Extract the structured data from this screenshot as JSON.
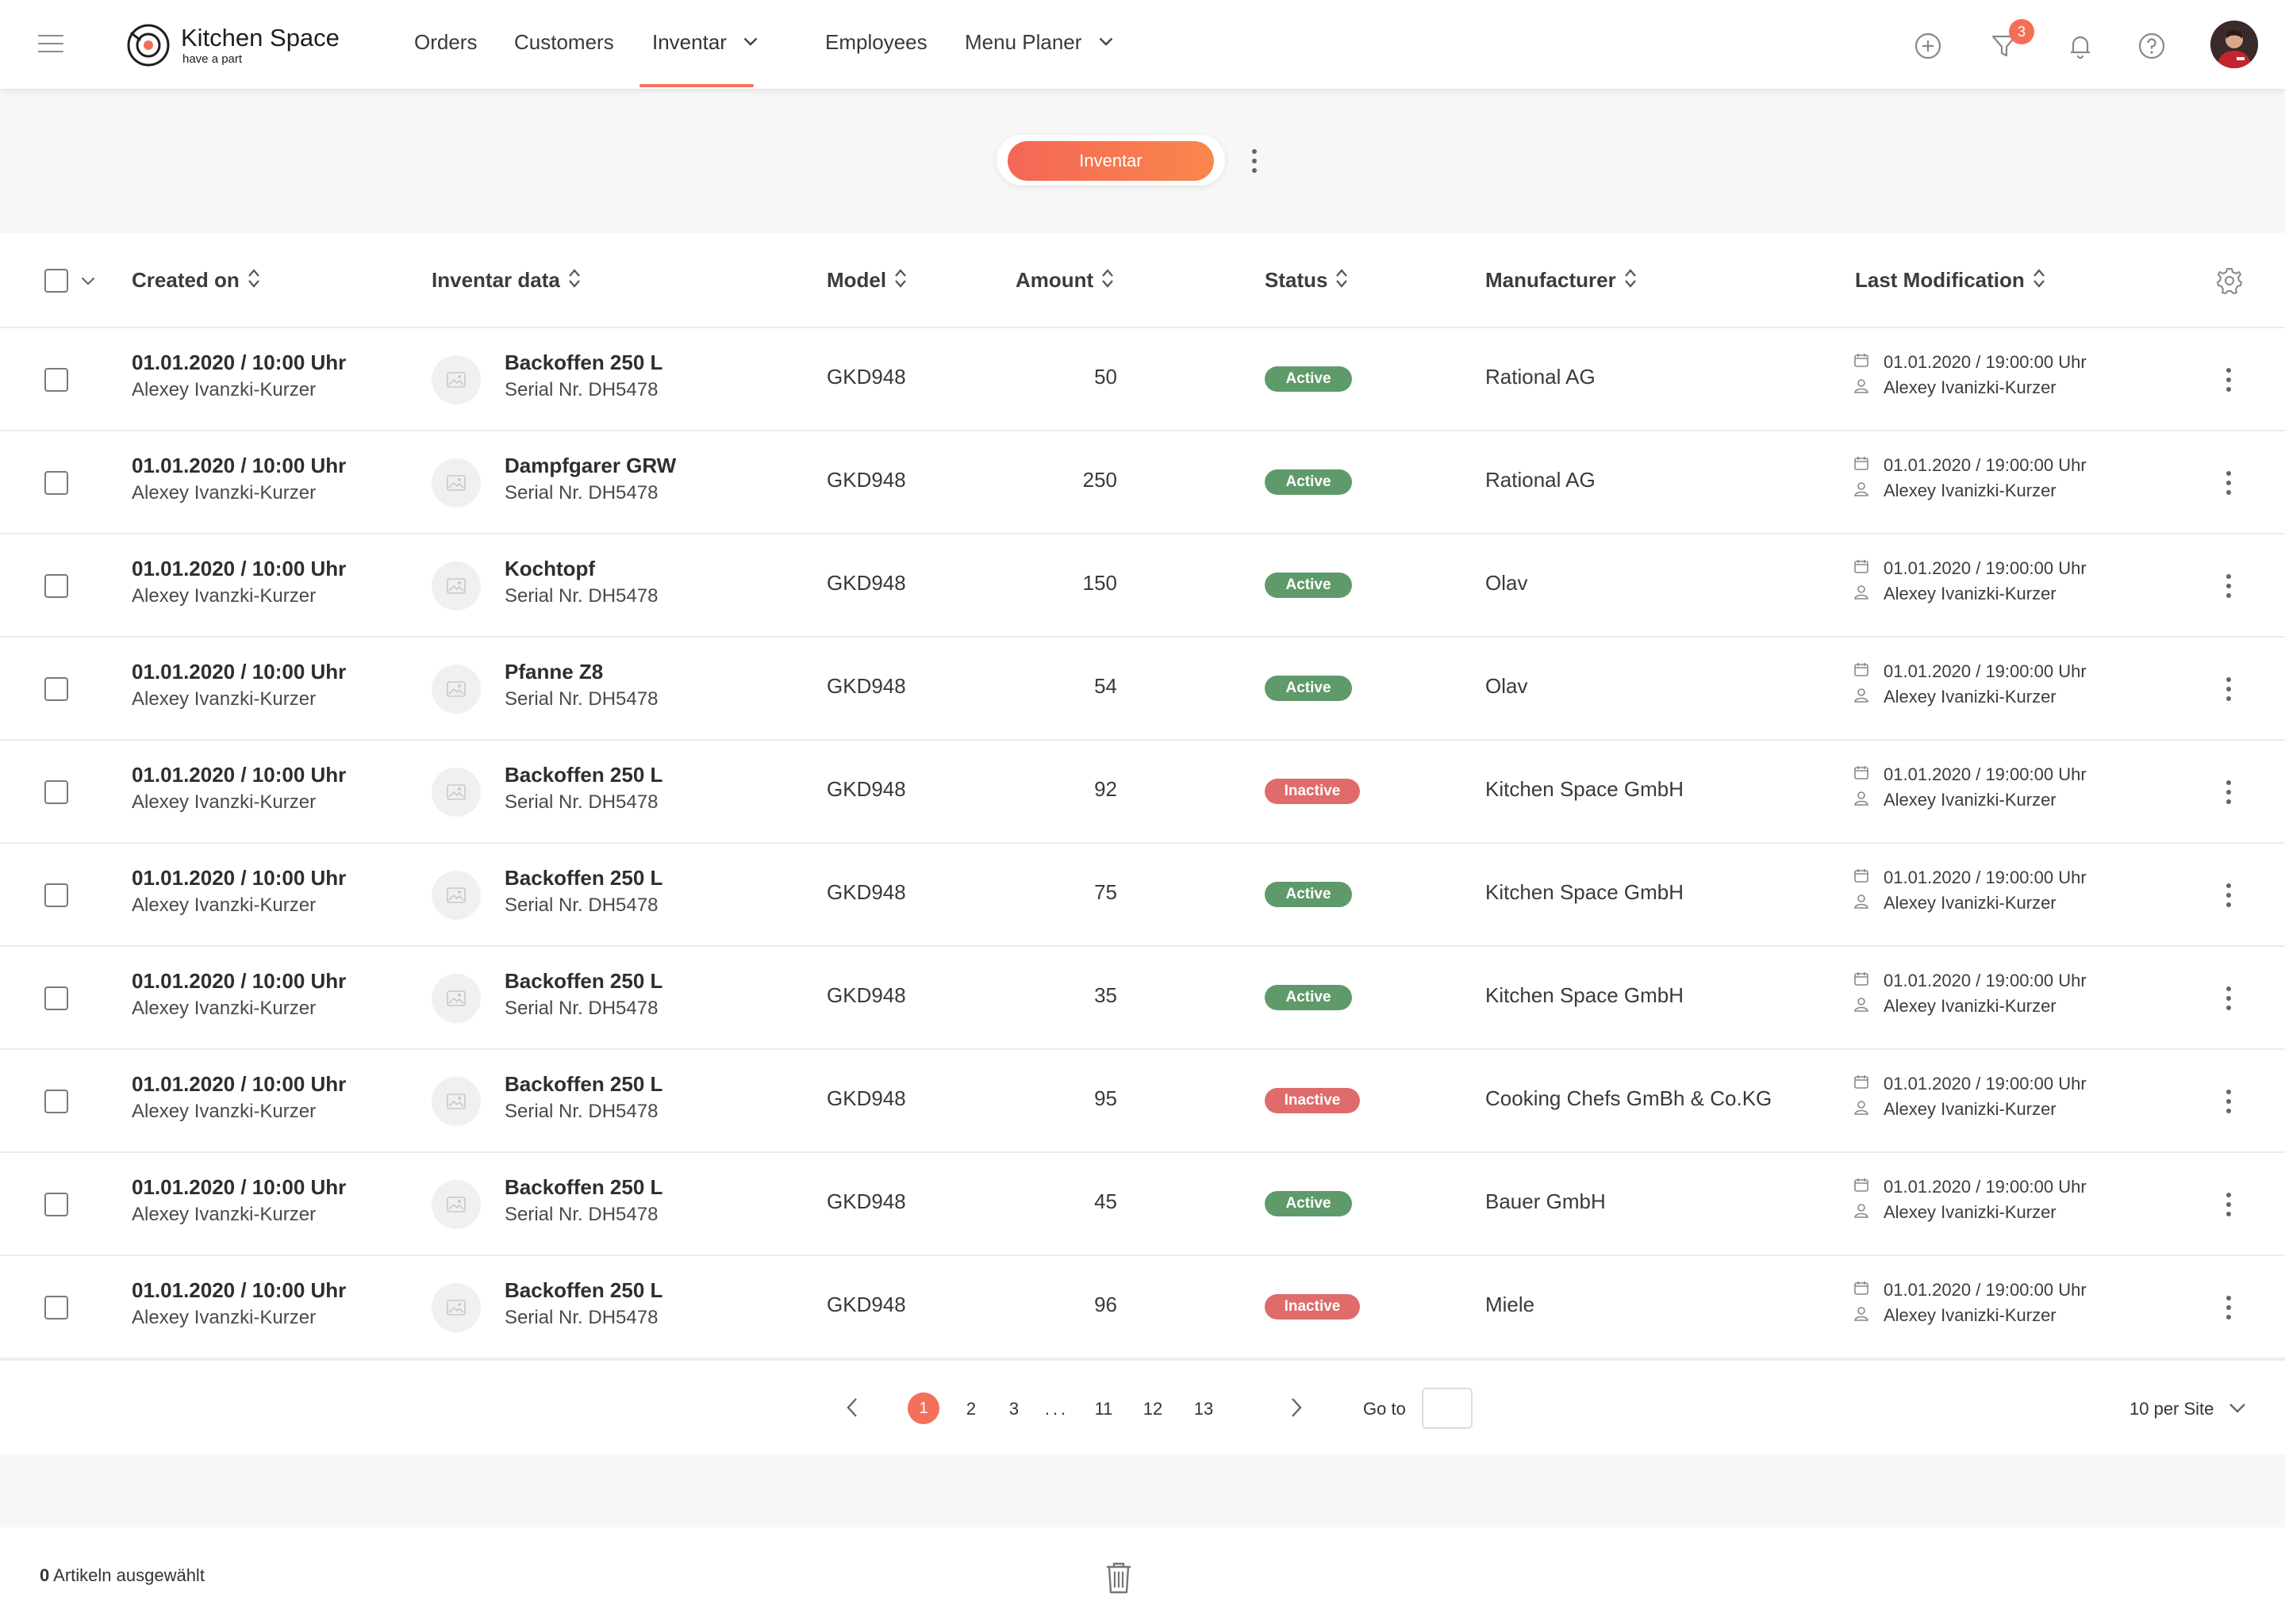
{
  "app": {
    "logo_name": "Kitchen Space",
    "logo_tagline": "have a part",
    "accent_color": "#f7735a"
  },
  "nav": {
    "items": [
      {
        "label": "Orders",
        "dropdown": false,
        "active": false
      },
      {
        "label": "Customers",
        "dropdown": false,
        "active": false
      },
      {
        "label": "Inventar",
        "dropdown": true,
        "active": true
      },
      {
        "label": "Employees",
        "dropdown": false,
        "active": false
      },
      {
        "label": "Menu Planer",
        "dropdown": true,
        "active": false
      }
    ]
  },
  "header_actions": {
    "icons": [
      "add-circle-icon",
      "filter-icon",
      "bell-icon",
      "help-icon"
    ],
    "filter_badge": "3"
  },
  "toolbar": {
    "primary_label": "Inventar"
  },
  "table": {
    "columns": [
      "Created on",
      "Inventar data",
      "Model",
      "Amount",
      "Status",
      "Manufacturer",
      "Last Modification"
    ],
    "rows": [
      {
        "created_date": "01.01.2020  /  10:00 Uhr",
        "created_by": "Alexey Ivanzki-Kurzer",
        "product": "Backoffen 250 L",
        "serial": "Serial Nr. DH5478",
        "model": "GKD948",
        "amount": "50",
        "status": "Active",
        "manufacturer": "Rational AG",
        "mod_date": "01.01.2020 / 19:00:00 Uhr",
        "mod_user": "Alexey Ivanizki-Kurzer"
      },
      {
        "created_date": "01.01.2020  /  10:00 Uhr",
        "created_by": "Alexey Ivanzki-Kurzer",
        "product": "Dampfgarer GRW",
        "serial": "Serial Nr. DH5478",
        "model": "GKD948",
        "amount": "250",
        "status": "Active",
        "manufacturer": "Rational AG",
        "mod_date": "01.01.2020 / 19:00:00 Uhr",
        "mod_user": "Alexey Ivanizki-Kurzer"
      },
      {
        "created_date": "01.01.2020  /  10:00 Uhr",
        "created_by": "Alexey Ivanzki-Kurzer",
        "product": "Kochtopf",
        "serial": "Serial Nr. DH5478",
        "model": "GKD948",
        "amount": "150",
        "status": "Active",
        "manufacturer": "Olav",
        "mod_date": "01.01.2020 / 19:00:00 Uhr",
        "mod_user": "Alexey Ivanizki-Kurzer"
      },
      {
        "created_date": "01.01.2020  /  10:00 Uhr",
        "created_by": "Alexey Ivanzki-Kurzer",
        "product": "Pfanne Z8",
        "serial": "Serial Nr. DH5478",
        "model": "GKD948",
        "amount": "54",
        "status": "Active",
        "manufacturer": "Olav",
        "mod_date": "01.01.2020 / 19:00:00 Uhr",
        "mod_user": "Alexey Ivanizki-Kurzer"
      },
      {
        "created_date": "01.01.2020  /  10:00 Uhr",
        "created_by": "Alexey Ivanzki-Kurzer",
        "product": "Backoffen 250 L",
        "serial": "Serial Nr. DH5478",
        "model": "GKD948",
        "amount": "92",
        "status": "Inactive",
        "manufacturer": "Kitchen Space GmbH",
        "mod_date": "01.01.2020 / 19:00:00 Uhr",
        "mod_user": "Alexey Ivanizki-Kurzer"
      },
      {
        "created_date": "01.01.2020  /  10:00 Uhr",
        "created_by": "Alexey Ivanzki-Kurzer",
        "product": "Backoffen 250 L",
        "serial": "Serial Nr. DH5478",
        "model": "GKD948",
        "amount": "75",
        "status": "Active",
        "manufacturer": "Kitchen Space GmbH",
        "mod_date": "01.01.2020 / 19:00:00 Uhr",
        "mod_user": "Alexey Ivanizki-Kurzer"
      },
      {
        "created_date": "01.01.2020  /  10:00 Uhr",
        "created_by": "Alexey Ivanzki-Kurzer",
        "product": "Backoffen 250 L",
        "serial": "Serial Nr. DH5478",
        "model": "GKD948",
        "amount": "35",
        "status": "Active",
        "manufacturer": "Kitchen Space GmbH",
        "mod_date": "01.01.2020 / 19:00:00 Uhr",
        "mod_user": "Alexey Ivanizki-Kurzer"
      },
      {
        "created_date": "01.01.2020  /  10:00 Uhr",
        "created_by": "Alexey Ivanzki-Kurzer",
        "product": "Backoffen 250 L",
        "serial": "Serial Nr. DH5478",
        "model": "GKD948",
        "amount": "95",
        "status": "Inactive",
        "manufacturer": "Cooking Chefs GmBh & Co.KG",
        "mod_date": "01.01.2020 / 19:00:00 Uhr",
        "mod_user": "Alexey Ivanizki-Kurzer"
      },
      {
        "created_date": "01.01.2020  /  10:00 Uhr",
        "created_by": "Alexey Ivanzki-Kurzer",
        "product": "Backoffen 250 L",
        "serial": "Serial Nr. DH5478",
        "model": "GKD948",
        "amount": "45",
        "status": "Active",
        "manufacturer": "Bauer GmbH",
        "mod_date": "01.01.2020 / 19:00:00 Uhr",
        "mod_user": "Alexey Ivanizki-Kurzer"
      },
      {
        "created_date": "01.01.2020  /  10:00 Uhr",
        "created_by": "Alexey Ivanzki-Kurzer",
        "product": "Backoffen 250 L",
        "serial": "Serial Nr. DH5478",
        "model": "GKD948",
        "amount": "96",
        "status": "Inactive",
        "manufacturer": "Miele",
        "mod_date": "01.01.2020 / 19:00:00 Uhr",
        "mod_user": "Alexey Ivanizki-Kurzer"
      }
    ],
    "status_colors": {
      "Active": "#5f9a6a",
      "Inactive": "#df6b6b"
    }
  },
  "pagination": {
    "pages": [
      "1",
      "2",
      "3",
      "...",
      "11",
      "12",
      "13"
    ],
    "current": "1",
    "goto_label": "Go to",
    "goto_value": "",
    "per_page": "10 per Site"
  },
  "footer": {
    "selected_count": "0",
    "selected_label": "Artikeln ausgewählt"
  }
}
